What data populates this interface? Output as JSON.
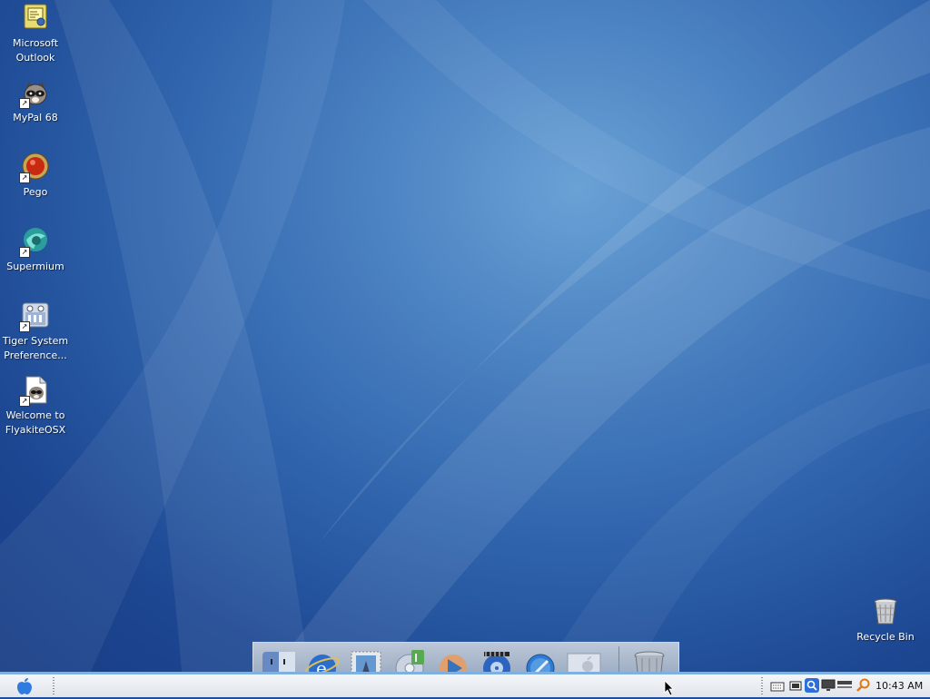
{
  "desktop": {
    "icons": [
      {
        "label_lines": [
          "Microsoft",
          "Outlook"
        ],
        "icon": "outlook-icon"
      },
      {
        "label_lines": [
          "MyPal 68",
          ""
        ],
        "icon": "mypal-raccoon-icon"
      },
      {
        "label_lines": [
          "Pego",
          ""
        ],
        "icon": "pego-icon"
      },
      {
        "label_lines": [
          "Supermium",
          ""
        ],
        "icon": "supermium-icon"
      },
      {
        "label_lines": [
          "Tiger System",
          "Preference..."
        ],
        "icon": "system-preferences-icon"
      },
      {
        "label_lines": [
          "Welcome to",
          "FlyakiteOSX"
        ],
        "icon": "welcome-document-icon"
      }
    ],
    "recycle_bin": {
      "label": "Recycle Bin",
      "icon": "recycle-bin-icon"
    }
  },
  "dock": {
    "items": [
      "finder-icon",
      "internet-explorer-icon",
      "mail-stamp-icon",
      "itunes-icon",
      "media-player-icon",
      "dvd-player-icon",
      "safari-icon",
      "system-apple-icon"
    ],
    "trash": "trash-icon"
  },
  "taskbar": {
    "start_icon": "apple-logo-icon",
    "tray_icons": [
      "keyboard-icon",
      "battery-icon",
      "search-tray-icon",
      "monitor-icon",
      "network-icon",
      "spotlight-icon"
    ],
    "clock": "10:43 AM"
  },
  "colors": {
    "accent": "#7fb0e2",
    "wallpaper": "#2f64ad",
    "taskbar": "#eef1f5"
  }
}
